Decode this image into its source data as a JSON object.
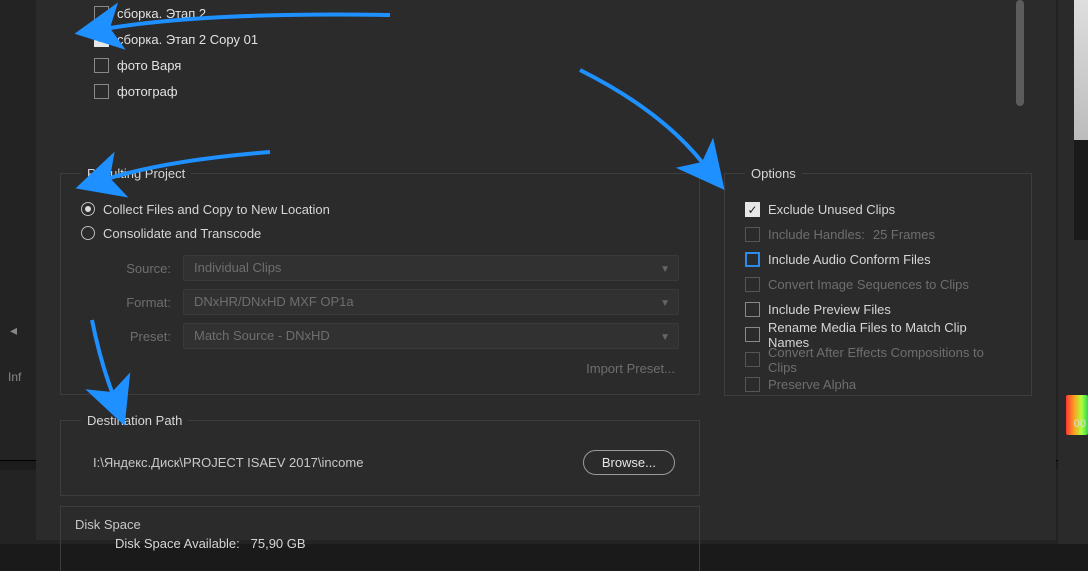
{
  "sequences": [
    {
      "label": "сборка. Этап 2",
      "checked": false
    },
    {
      "label": "сборка. Этап 2 Copy 01",
      "checked": true
    },
    {
      "label": "фото Варя",
      "checked": false
    },
    {
      "label": "фотограф",
      "checked": false
    }
  ],
  "resultingProject": {
    "title": "Resulting Project",
    "radio1": "Collect Files and Copy to New Location",
    "radio2": "Consolidate and Transcode",
    "sourceLabel": "Source:",
    "sourceValue": "Individual Clips",
    "formatLabel": "Format:",
    "formatValue": "DNxHR/DNxHD MXF OP1a",
    "presetLabel": "Preset:",
    "presetValue": "Match Source - DNxHD",
    "importPreset": "Import Preset..."
  },
  "options": {
    "title": "Options",
    "excludeUnused": "Exclude Unused Clips",
    "includeHandlesPrefix": "Include Handles:",
    "includeHandlesValue": "25 Frames",
    "includeAudio": "Include Audio Conform Files",
    "convertImg": "Convert Image Sequences to Clips",
    "includePreview": "Include Preview Files",
    "renameMedia": "Rename Media Files to Match Clip Names",
    "convertAE": "Convert After Effects Compositions to Clips",
    "preserveAlpha": "Preserve Alpha"
  },
  "destination": {
    "title": "Destination Path",
    "path": "I:\\Яндекс.Диск\\PROJECT ISAEV 2017\\income",
    "browse": "Browse..."
  },
  "disk": {
    "title": "Disk Space",
    "availLabel": "Disk Space Available:",
    "availValue": "75,90 GB"
  },
  "bg": {
    "timelineMarker": "00",
    "infoLabel": "Inf"
  }
}
